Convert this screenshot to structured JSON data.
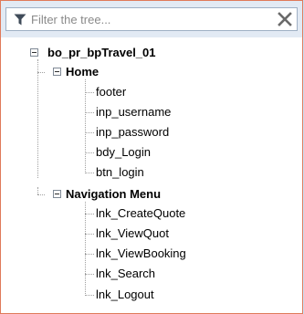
{
  "filter": {
    "placeholder": "Filter the tree...",
    "funnel_icon": "funnel-icon",
    "clear_icon": "close-icon"
  },
  "tree": {
    "root": "bo_pr_bpTravel_01",
    "groups": [
      {
        "label": "Home",
        "items": [
          "footer",
          "inp_username",
          "inp_password",
          "bdy_Login",
          "btn_login"
        ]
      },
      {
        "label": "Navigation Menu",
        "items": [
          "lnk_CreateQuote",
          "lnk_ViewQuot",
          "lnk_ViewBooking",
          "lnk_Search",
          "lnk_Logout"
        ]
      }
    ]
  },
  "colors": {
    "page_background": "#c7dff5",
    "panel_border": "#e07a5a",
    "filter_bar": "#e2eaf4"
  }
}
